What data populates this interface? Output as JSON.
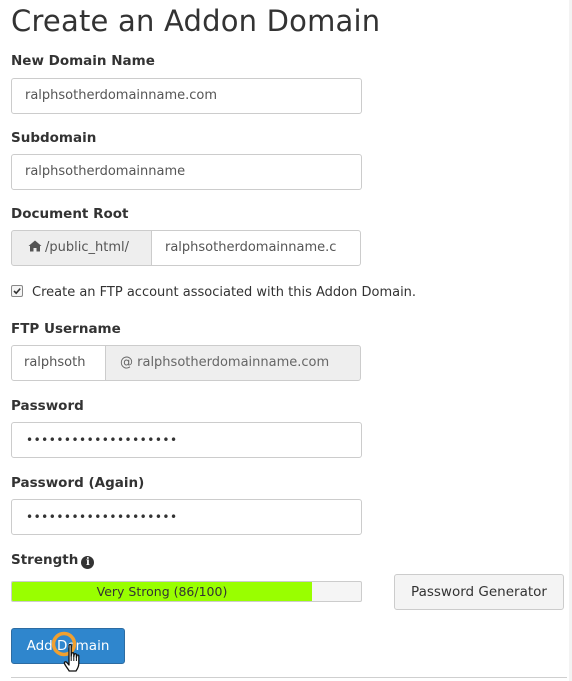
{
  "page_title": "Create an Addon Domain",
  "new_domain": {
    "label": "New Domain Name",
    "value": "ralphsotherdomainname.com"
  },
  "subdomain": {
    "label": "Subdomain",
    "value": "ralphsotherdomainname"
  },
  "document_root": {
    "label": "Document Root",
    "prefix_icon": "home-icon",
    "prefix": "/public_html/",
    "value": "ralphsotherdomainname.c"
  },
  "ftp_checkbox": {
    "checked": true,
    "label": "Create an FTP account associated with this Addon Domain."
  },
  "ftp_username": {
    "label": "FTP Username",
    "value": "ralphsoth",
    "suffix": "@ ralphsotherdomainname.com"
  },
  "password": {
    "label": "Password",
    "value": "••••••••••••••••••••"
  },
  "password_again": {
    "label": "Password (Again)",
    "value": "••••••••••••••••••••"
  },
  "strength": {
    "label": "Strength",
    "info_icon": "info-circle-icon",
    "text": "Very Strong (86/100)",
    "score": 86,
    "max": 100,
    "bar_color": "#99ff00"
  },
  "buttons": {
    "password_generator": "Password Generator",
    "add_domain": "Add Domain"
  },
  "colors": {
    "primary_button": "#2f86cd",
    "click_highlight": "#f0a030"
  }
}
